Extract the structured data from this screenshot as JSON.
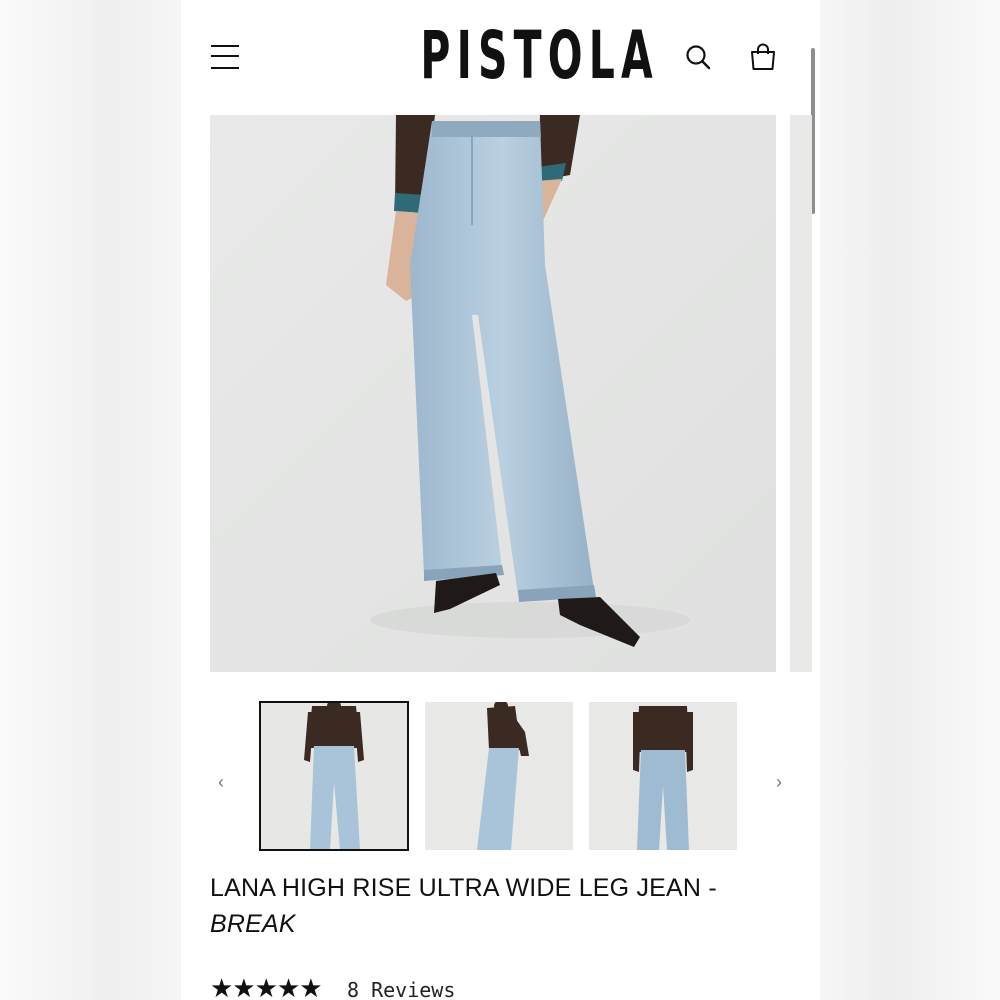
{
  "header": {
    "logo_text": "PISTOLA",
    "menu_icon": "hamburger-menu-icon",
    "search_icon": "search-icon",
    "cart_icon": "shopping-bag-icon"
  },
  "gallery": {
    "main_image": "model wearing light wash wide leg jeans, brown long-sleeve top, black pointed heels",
    "thumbnails": [
      {
        "view": "front",
        "selected": true
      },
      {
        "view": "side",
        "selected": false
      },
      {
        "view": "back",
        "selected": false
      }
    ],
    "prev_arrow": "‹",
    "next_arrow": "›"
  },
  "product": {
    "title": "LANA HIGH RISE ULTRA WIDE LEG JEAN -",
    "variant": "BREAK",
    "stars": "★★★★★",
    "rating": 5,
    "reviews_label": "8 Reviews"
  },
  "colors": {
    "denim": "#a9c3d8",
    "top": "#3b2a22",
    "background": "#ffffff",
    "text": "#111111"
  }
}
